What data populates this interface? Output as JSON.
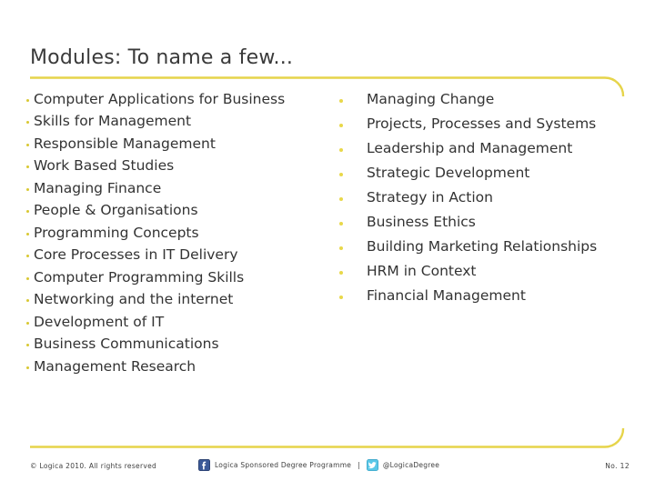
{
  "slide": {
    "title": "Modules: To name a few...",
    "accent_color": "#e6d44a",
    "text_color": "#333333",
    "background": "#ffffff"
  },
  "columns": {
    "left": [
      "Computer Applications for Business",
      "Skills for Management",
      "Responsible Management",
      "Work Based Studies",
      "Managing Finance",
      "People & Organisations",
      "Programming Concepts",
      "Core Processes in IT Delivery",
      "Computer Programming Skills",
      "Networking and the internet",
      "Development of IT",
      "Business Communications",
      "Management Research"
    ],
    "right": [
      "Managing Change",
      "Projects, Processes and Systems",
      "Leadership and Management",
      "Strategic Development",
      "Strategy in Action",
      "Business Ethics",
      "Building Marketing Relationships",
      "HRM in Context",
      "Financial Management"
    ]
  },
  "footer": {
    "copyright": "© Logica 2010. All rights reserved",
    "facebook_label": "Logica Sponsored Degree Programme",
    "separator": "|",
    "twitter_label": "@LogicaDegree",
    "page_number": "No. 12",
    "facebook_color": "#3b5998",
    "twitter_color": "#5bc8e8"
  }
}
